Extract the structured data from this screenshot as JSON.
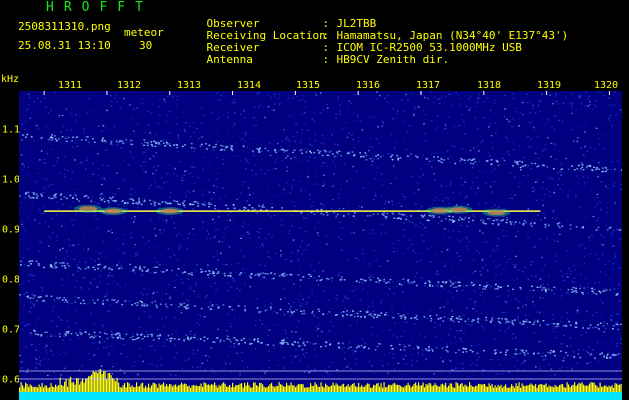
{
  "header": {
    "app_logo": "HROFFT",
    "file_name": "2508311310.png",
    "datetime": "25.08.31 13:10",
    "meteor_label": "meteor",
    "meteor_count": "30"
  },
  "station_info": [
    {
      "key": "Observer",
      "sep": ":",
      "value": "JL2TBB"
    },
    {
      "key": "Receiving Location",
      "sep": ":",
      "value": "Hamamatsu, Japan (N34°40' E137°43')"
    },
    {
      "key": "Receiver",
      "sep": ":",
      "value": "ICOM IC-R2500 53.1000MHz USB"
    },
    {
      "key": "Antenna",
      "sep": ":",
      "value": "HB9CV Zenith dir."
    }
  ],
  "axes": {
    "y_unit": "kHz",
    "x_ticks": [
      "1311",
      "1312",
      "1313",
      "1314",
      "1315",
      "1316",
      "1317",
      "1318",
      "1319",
      "1320"
    ],
    "y_ticks": [
      "1.1",
      "1.0",
      "0.9",
      "0.8",
      "0.7",
      "0.6"
    ]
  },
  "chart_data": {
    "type": "heatmap",
    "title": "",
    "x_ticks": [
      1311,
      1312,
      1313,
      1314,
      1315,
      1316,
      1317,
      1318,
      1319,
      1320
    ],
    "xlim": [
      1310.6,
      1320.2
    ],
    "y_ticks": [
      1.1,
      1.0,
      0.9,
      0.8,
      0.7,
      0.6
    ],
    "ylim": [
      0.57,
      1.2
    ],
    "ylabel": "kHz",
    "marker_line_khz": 0.955,
    "marker_line_x_range": [
      1311,
      1318.9
    ],
    "interference_bands": [
      {
        "start_khz": 1.11,
        "end_khz": 1.04
      },
      {
        "start_khz": 0.99,
        "end_khz": 0.92
      },
      {
        "start_khz": 0.85,
        "end_khz": 0.79
      },
      {
        "start_khz": 0.78,
        "end_khz": 0.72
      },
      {
        "start_khz": 0.71,
        "end_khz": 0.66
      }
    ],
    "meteor_echoes": [
      {
        "x": 1311.7,
        "y_khz": 0.96
      },
      {
        "x": 1312.1,
        "y_khz": 0.955
      },
      {
        "x": 1313.0,
        "y_khz": 0.955
      },
      {
        "x": 1317.3,
        "y_khz": 0.956
      },
      {
        "x": 1317.6,
        "y_khz": 0.958
      },
      {
        "x": 1318.2,
        "y_khz": 0.952
      }
    ],
    "colors": {
      "background": "#000080",
      "noise": "#1e3ce0",
      "band": "#8fc7ff",
      "marker_line": "#ffff40",
      "echo": "#ff4040",
      "bottom_bar": "#ffff00",
      "bottom_strip": "#00e5ff"
    }
  }
}
